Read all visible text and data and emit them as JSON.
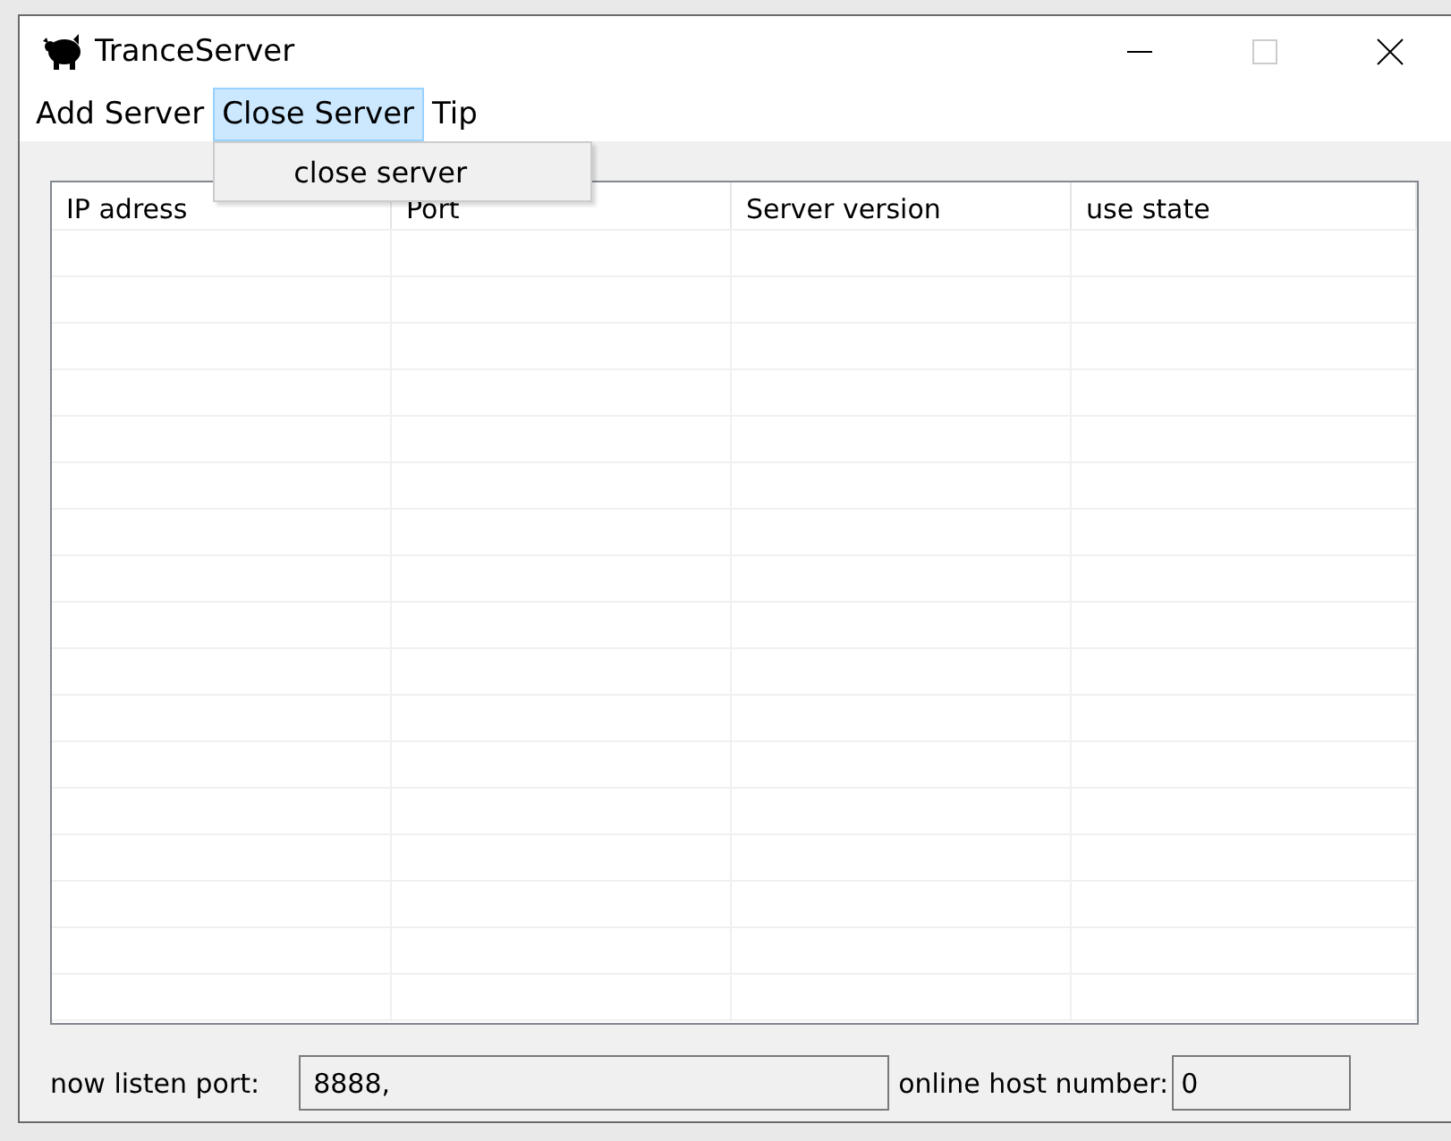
{
  "window": {
    "title": "TranceServer",
    "maximize_disabled": true
  },
  "menu": [
    {
      "label": "Add Server",
      "selected": false
    },
    {
      "label": "Close Server",
      "selected": true,
      "items": [
        "close server"
      ]
    },
    {
      "label": "Tip",
      "selected": false
    }
  ],
  "table": {
    "columns": [
      "IP adress",
      "Port",
      "Server version",
      "use state"
    ]
  },
  "footer": {
    "port_label": "now  listen port:",
    "port_value": "8888,",
    "online_label": "online host number:",
    "online_value": "0"
  }
}
